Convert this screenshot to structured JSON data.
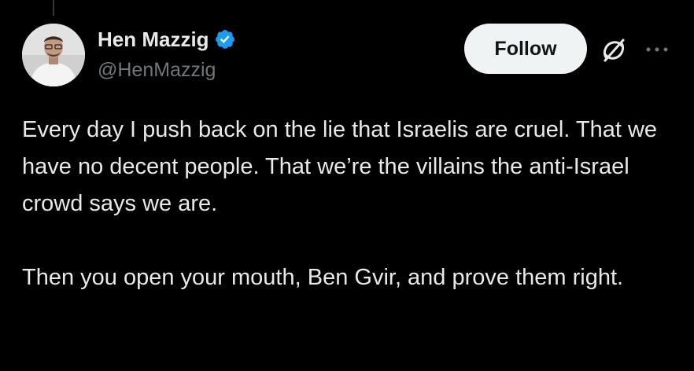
{
  "author": {
    "display_name": "Hen Mazzig",
    "handle": "@HenMazzig",
    "verified": true,
    "avatar_icon": "profile-photo"
  },
  "actions": {
    "follow_label": "Follow",
    "grok_icon": "grok-icon",
    "more_icon": "more-icon"
  },
  "tweet": {
    "paragraphs": [
      "Every day I push back on the lie that Israelis are cruel. That we have no decent people. That we’re the villains the anti-Israel crowd says we are.",
      "Then you open your mouth, Ben Gvir, and prove them right."
    ]
  },
  "colors": {
    "background": "#000000",
    "text": "#e7e9ea",
    "secondary_text": "#71767b",
    "verified_blue": "#1d9bf0",
    "follow_bg": "#eff3f4",
    "follow_text": "#0f1419"
  }
}
